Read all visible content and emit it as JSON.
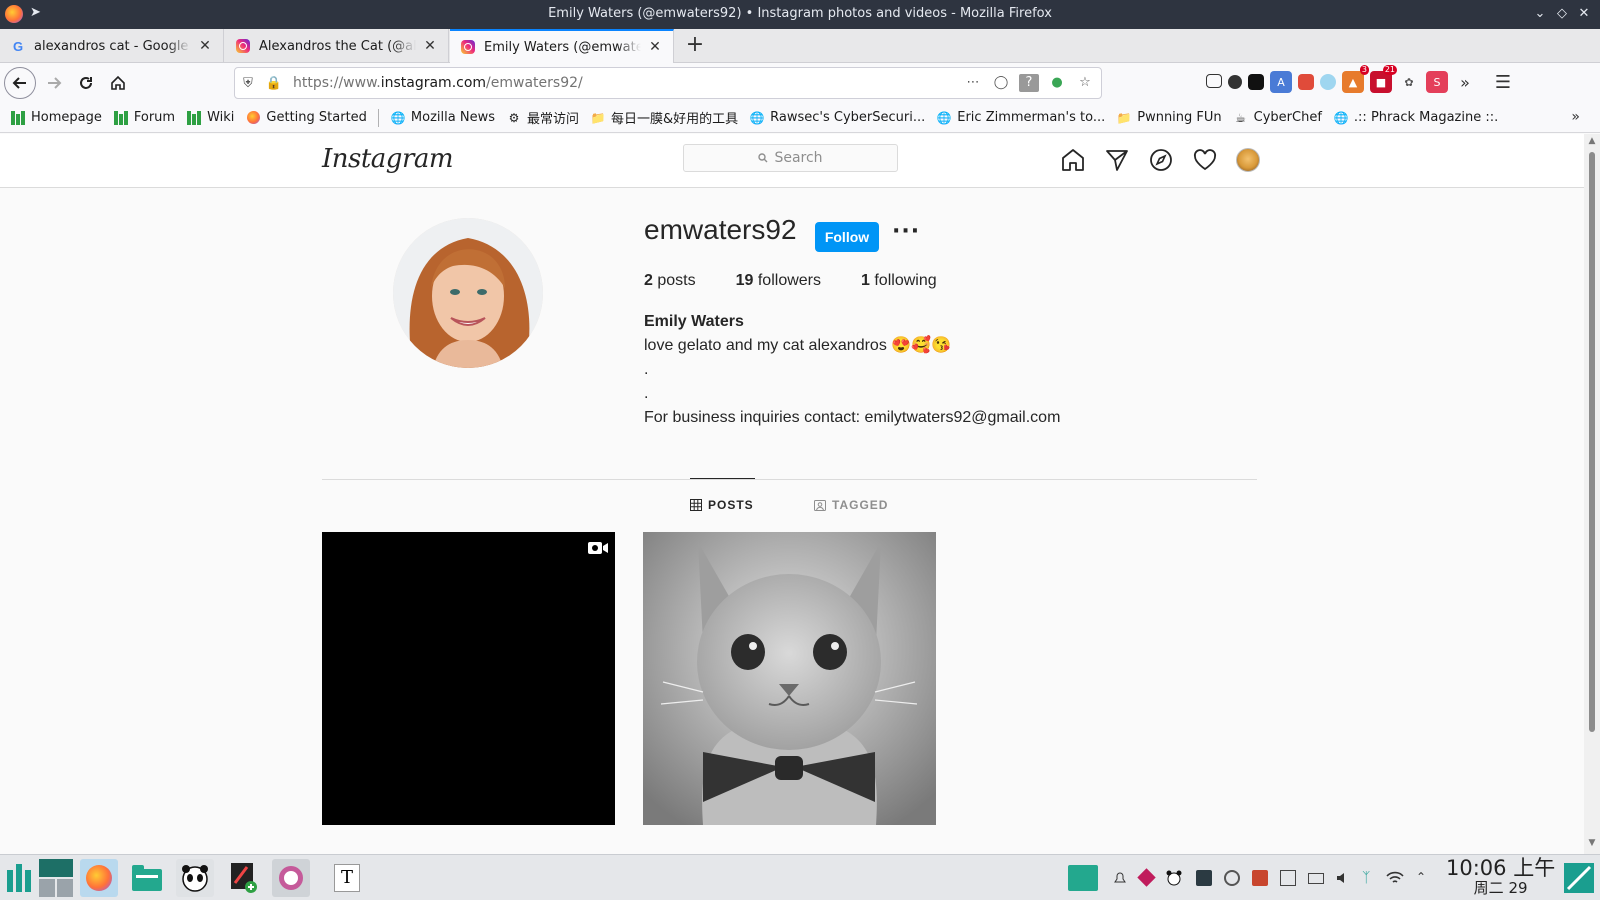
{
  "window": {
    "title": "Emily Waters (@emwaters92) • Instagram photos and videos - Mozilla Firefox"
  },
  "tabs": [
    {
      "label": "alexandros cat - Google Se",
      "favicon": "google-icon"
    },
    {
      "label": "Alexandros the Cat (@alex",
      "favicon": "instagram-icon"
    },
    {
      "label": "Emily Waters (@emwaters",
      "favicon": "instagram-icon",
      "active": true
    }
  ],
  "address": {
    "prefix": "https://www.",
    "domain": "instagram.com",
    "path": "/emwaters92/"
  },
  "extensions": {
    "badge_a": "3",
    "badge_b": "21"
  },
  "bookmarks": [
    {
      "label": "Homepage",
      "icon": "green-bars-icon"
    },
    {
      "label": "Forum",
      "icon": "green-bars-icon"
    },
    {
      "label": "Wiki",
      "icon": "green-bars-icon"
    },
    {
      "label": "Getting Started",
      "icon": "firefox-icon"
    },
    {
      "label": "Mozilla News",
      "icon": "globe-icon"
    },
    {
      "label": "最常访问",
      "icon": "gear-icon"
    },
    {
      "label": "每日一膜&好用的工具",
      "icon": "folder-icon"
    },
    {
      "label": "Rawsec's CyberSecuri...",
      "icon": "globe-icon"
    },
    {
      "label": "Eric Zimmerman's to...",
      "icon": "globe-icon"
    },
    {
      "label": "Pwnning FUn",
      "icon": "folder-icon"
    },
    {
      "label": "CyberChef",
      "icon": "chef-icon"
    },
    {
      "label": ".:: Phrack Magazine ::.",
      "icon": "globe-icon"
    }
  ],
  "instagram": {
    "logo": "Instagram",
    "search_placeholder": "Search",
    "profile": {
      "username": "emwaters92",
      "follow_label": "Follow",
      "posts_count": "2",
      "posts_label": "posts",
      "followers_count": "19",
      "followers_label": "followers",
      "following_count": "1",
      "following_label": "following",
      "full_name": "Emily Waters",
      "bio_line1": "love gelato and my cat alexandros 😍🥰😘",
      "bio_line2": ".",
      "bio_line3": ".",
      "bio_line4": "For business inquiries contact: emilytwaters92@gmail.com"
    },
    "tabs": {
      "posts": "POSTS",
      "tagged": "TAGGED"
    }
  },
  "taskbar": {
    "time": "10:06 上午",
    "date": "周二 29"
  },
  "colors": {
    "follow_blue": "#0095f6",
    "firefox_titlebar": "#2e3440",
    "tab_accent": "#0a84ff"
  }
}
